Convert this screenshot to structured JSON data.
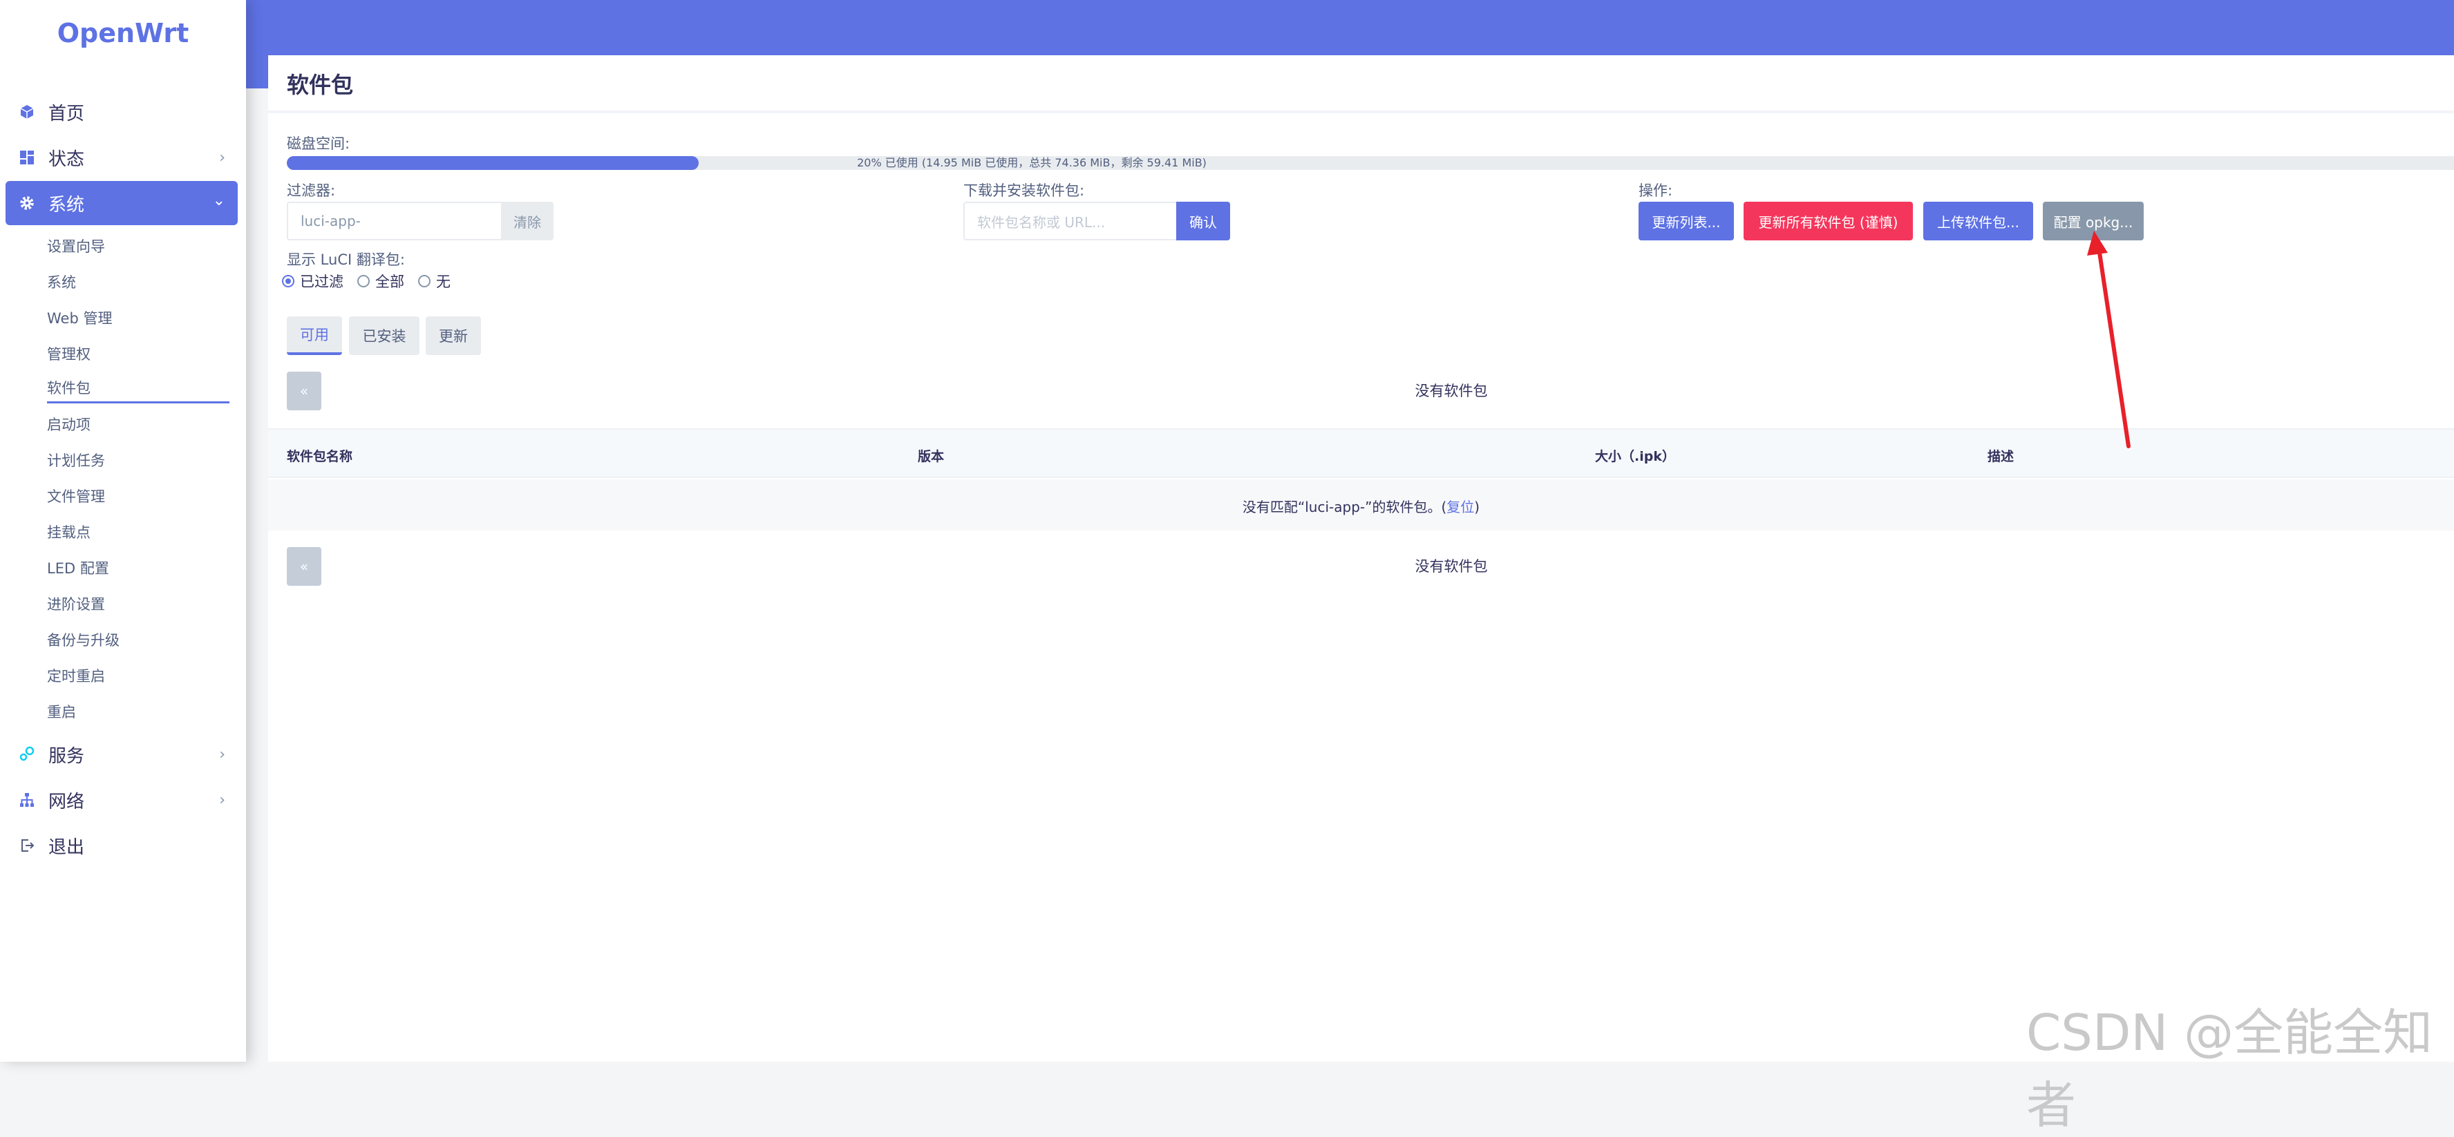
{
  "sidebar": {
    "logo": "OpenWrt",
    "items": [
      {
        "label": "首页"
      },
      {
        "label": "状态"
      },
      {
        "label": "系统"
      },
      {
        "label": "服务"
      },
      {
        "label": "网络"
      },
      {
        "label": "退出"
      }
    ],
    "system_sub": [
      {
        "label": "设置向导"
      },
      {
        "label": "系统"
      },
      {
        "label": "Web 管理"
      },
      {
        "label": "管理权"
      },
      {
        "label": "软件包"
      },
      {
        "label": "启动项"
      },
      {
        "label": "计划任务"
      },
      {
        "label": "文件管理"
      },
      {
        "label": "挂载点"
      },
      {
        "label": "LED 配置"
      },
      {
        "label": "进阶设置"
      },
      {
        "label": "备份与升级"
      },
      {
        "label": "定时重启"
      },
      {
        "label": "重启"
      }
    ]
  },
  "page": {
    "title": "软件包",
    "disk_label": "磁盘空间:",
    "disk_used_fraction": 0.2,
    "disk_text": "20% 已使用 (14.95 MiB 已使用，总共 74.36 MiB，剩余 59.41 MiB)",
    "filter_label": "过滤器:",
    "filter_value": "luci-app-",
    "clear_label": "清除",
    "download_label": "下载并安装软件包:",
    "download_placeholder": "软件包名称或 URL...",
    "confirm_label": "确认",
    "actions_label": "操作:",
    "update_lists": "更新列表...",
    "upgrade_all": "更新所有软件包 (谨慎)",
    "upload_package": "上传软件包...",
    "configure_opkg": "配置 opkg...",
    "translation_label": "显示 LuCI 翻译包:",
    "radio_filtered": "已过滤",
    "radio_all": "全部",
    "radio_none": "无",
    "tab_available": "可用",
    "tab_installed": "已安装",
    "tab_updates": "更新",
    "pager_prev": "«",
    "no_packages": "没有软件包",
    "col_name": "软件包名称",
    "col_version": "版本",
    "col_size": "大小（.ipk）",
    "col_desc": "描述",
    "empty_prefix": "没有匹配“",
    "empty_filter": "luci-app-",
    "empty_suffix": "”的软件包。(",
    "empty_reset": "复位",
    "empty_close": ")"
  },
  "watermark": "CSDN @全能全知者",
  "colors": {
    "accent": "#5e72e4",
    "danger": "#f5365c",
    "gray": "#8898aa",
    "annotation_arrow": "#e8202a"
  }
}
